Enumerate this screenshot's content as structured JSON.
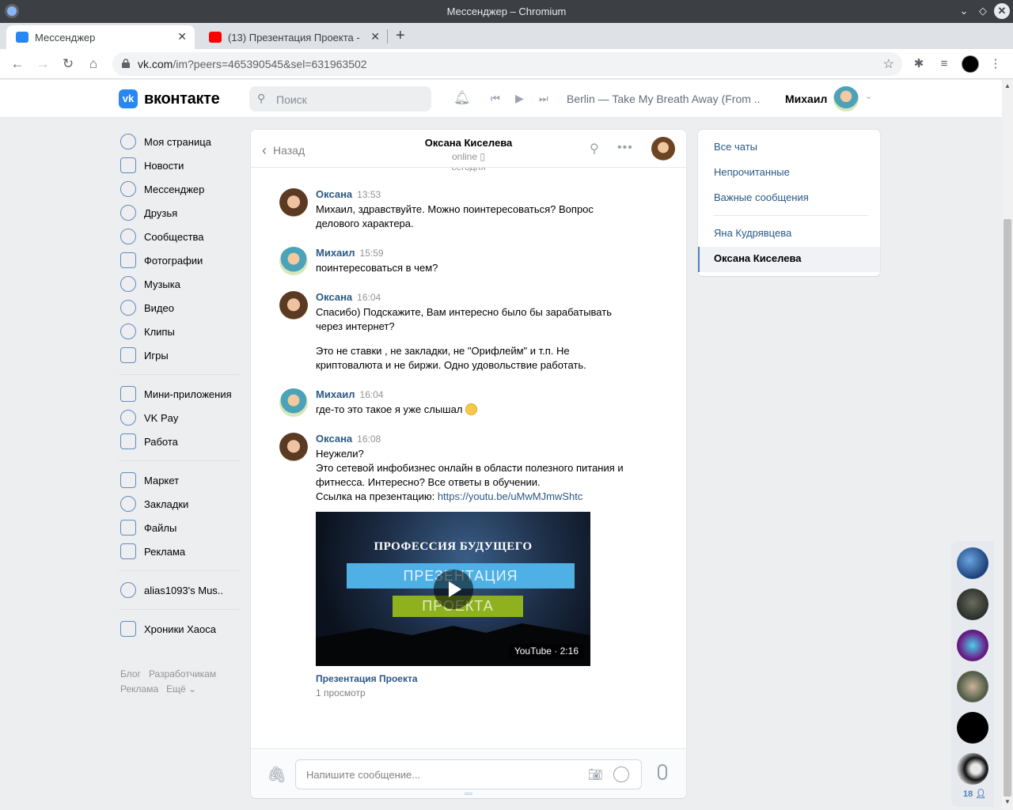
{
  "browser": {
    "window_title": "Мессенджер – Chromium",
    "tabs": [
      {
        "label": "Мессенджер",
        "favicon_color": "#2787f5",
        "active": true
      },
      {
        "label": "(13) Презентация Проекта - ",
        "favicon_color": "#ff0000",
        "active": false
      }
    ],
    "url_host": "vk.com",
    "url_path": "/im?peers=465390545&sel=631963502"
  },
  "header": {
    "logo_text": "вконтакте",
    "logo_letter": "vk",
    "search_placeholder": "Поиск",
    "track": "Berlin — Take My Breath Away (From ...",
    "user_name": "Михаил"
  },
  "nav": {
    "group1": [
      "Моя страница",
      "Новости",
      "Мессенджер",
      "Друзья",
      "Сообщества",
      "Фотографии",
      "Музыка",
      "Видео",
      "Клипы",
      "Игры"
    ],
    "group2": [
      "Мини-приложения",
      "VK Pay",
      "Работа"
    ],
    "group3": [
      "Маркет",
      "Закладки",
      "Файлы",
      "Реклама"
    ],
    "group4": [
      "alias1093's Mus.."
    ],
    "group5": [
      "Хроники Хаоса"
    ],
    "footer": [
      "Блог",
      "Разработчикам",
      "Реклама",
      "Ещё ⌄"
    ]
  },
  "chat": {
    "back_label": "Назад",
    "contact_name": "Оксана Киселева",
    "contact_status": "online",
    "date_divider": "сегодня",
    "messages": [
      {
        "author": "Оксана",
        "time": "13:53",
        "paragraphs": [
          "Михаил, здравствуйте. Можно поинтересоваться? Вопрос делового характера."
        ]
      },
      {
        "author": "Михаил",
        "time": "15:59",
        "paragraphs": [
          "поинтересоваться в чем?"
        ]
      },
      {
        "author": "Оксана",
        "time": "16:04",
        "paragraphs": [
          "Спасибо) Подскажите, Вам интересно было бы зарабатывать через интернет?",
          "Это не ставки , не закладки, не \"Орифлейм\" и т.п. Не криптовалюта и не биржи. Одно удовольствие работать."
        ]
      },
      {
        "author": "Михаил",
        "time": "16:04",
        "paragraphs": [
          "где-то это такое я уже слышал"
        ]
      },
      {
        "author": "Оксана",
        "time": "16:08",
        "lines": [
          "Неужели?",
          "Это сетевой инфобизнес онлайн в области полезного питания и фитнесса. Интересно? Все ответы в обучении."
        ],
        "link_prefix": "Ссылка на презентацию: ",
        "link": "https://youtu.be/uMwMJmwShtc"
      }
    ],
    "video": {
      "heading": "ПРОФЕССИЯ БУДУЩЕГО",
      "band1": "ПРЕЗЕНТАЦИЯ",
      "band2": "ПРОЕКТА",
      "badge": "YouTube · 2:16",
      "title": "Презентация Проекта",
      "views": "1 просмотр"
    },
    "composer_placeholder": "Напишите сообщение..."
  },
  "right_panel": {
    "filters": [
      "Все чаты",
      "Непрочитанные",
      "Важные сообщения"
    ],
    "chats": [
      "Яна Кудрявцева",
      "Оксана Киселева"
    ]
  },
  "floating": {
    "count": "18"
  }
}
